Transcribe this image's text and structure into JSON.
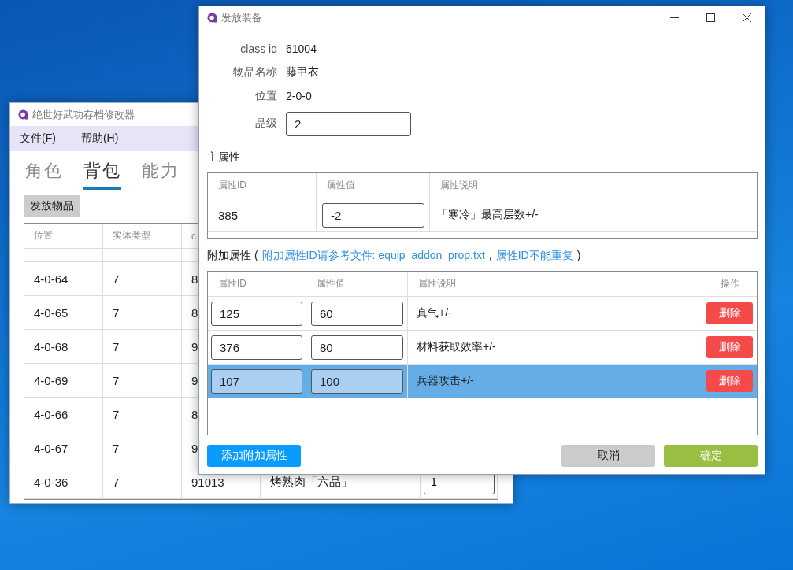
{
  "main_window": {
    "title": "绝世好武功存档修改器",
    "menu": [
      {
        "label": "文件(F)"
      },
      {
        "label": "帮助(H)"
      }
    ],
    "tabs": [
      {
        "label": "角色",
        "selected": false
      },
      {
        "label": "背包",
        "selected": true
      },
      {
        "label": "能力",
        "selected": false
      }
    ],
    "issue_button": "发放物品",
    "table": {
      "columns": [
        "位置",
        "实体类型",
        "c"
      ],
      "rows": [
        {
          "cells": [
            "4-0-64",
            "7",
            "8"
          ]
        },
        {
          "cells": [
            "4-0-65",
            "7",
            "8"
          ]
        },
        {
          "cells": [
            "4-0-68",
            "7",
            "9"
          ]
        },
        {
          "cells": [
            "4-0-69",
            "7",
            "9"
          ]
        },
        {
          "cells": [
            "4-0-66",
            "7",
            "8"
          ]
        },
        {
          "cells": [
            "4-0-67",
            "7",
            "9"
          ]
        },
        {
          "cells": [
            "4-0-36",
            "7",
            "91013",
            "烤熟肉「六品」"
          ],
          "quantity": "1"
        }
      ]
    }
  },
  "dialog": {
    "title": "发放装备",
    "fields": [
      {
        "kind": "text",
        "label": "class id",
        "value": "61004"
      },
      {
        "kind": "text",
        "label": "物品名称",
        "value": "藤甲衣"
      },
      {
        "kind": "text",
        "label": "位置",
        "value": "2-0-0"
      },
      {
        "kind": "input",
        "label": "品级",
        "value": "2"
      }
    ],
    "main_attr": {
      "title": "主属性",
      "columns": [
        "属性ID",
        "属性值",
        "属性说明"
      ],
      "rows": [
        {
          "id": "385",
          "value": "-2",
          "description": "「寒冷」最高层数+/-"
        }
      ]
    },
    "addon_note": {
      "prefix": "附加属性 (",
      "links": [
        "附加属性ID请参考文件: equip_addon_prop.txt",
        "属性ID不能重复"
      ],
      "separator": ",",
      "suffix": ")"
    },
    "addon_attr": {
      "columns": [
        "属性ID",
        "属性值",
        "属性说明",
        "操作"
      ],
      "rows": [
        {
          "id": "125",
          "value": "60",
          "description": "真气+/-",
          "action": "删除",
          "selected": false
        },
        {
          "id": "376",
          "value": "80",
          "description": "材料获取效率+/-",
          "action": "删除",
          "selected": false
        },
        {
          "id": "107",
          "value": "100",
          "description": "兵器攻击+/-",
          "action": "删除",
          "selected": true
        }
      ]
    },
    "buttons": [
      {
        "kind": "add",
        "label": "添加附加属性"
      },
      {
        "kind": "cancel",
        "label": "取消"
      },
      {
        "kind": "confirm",
        "label": "确定"
      }
    ]
  }
}
